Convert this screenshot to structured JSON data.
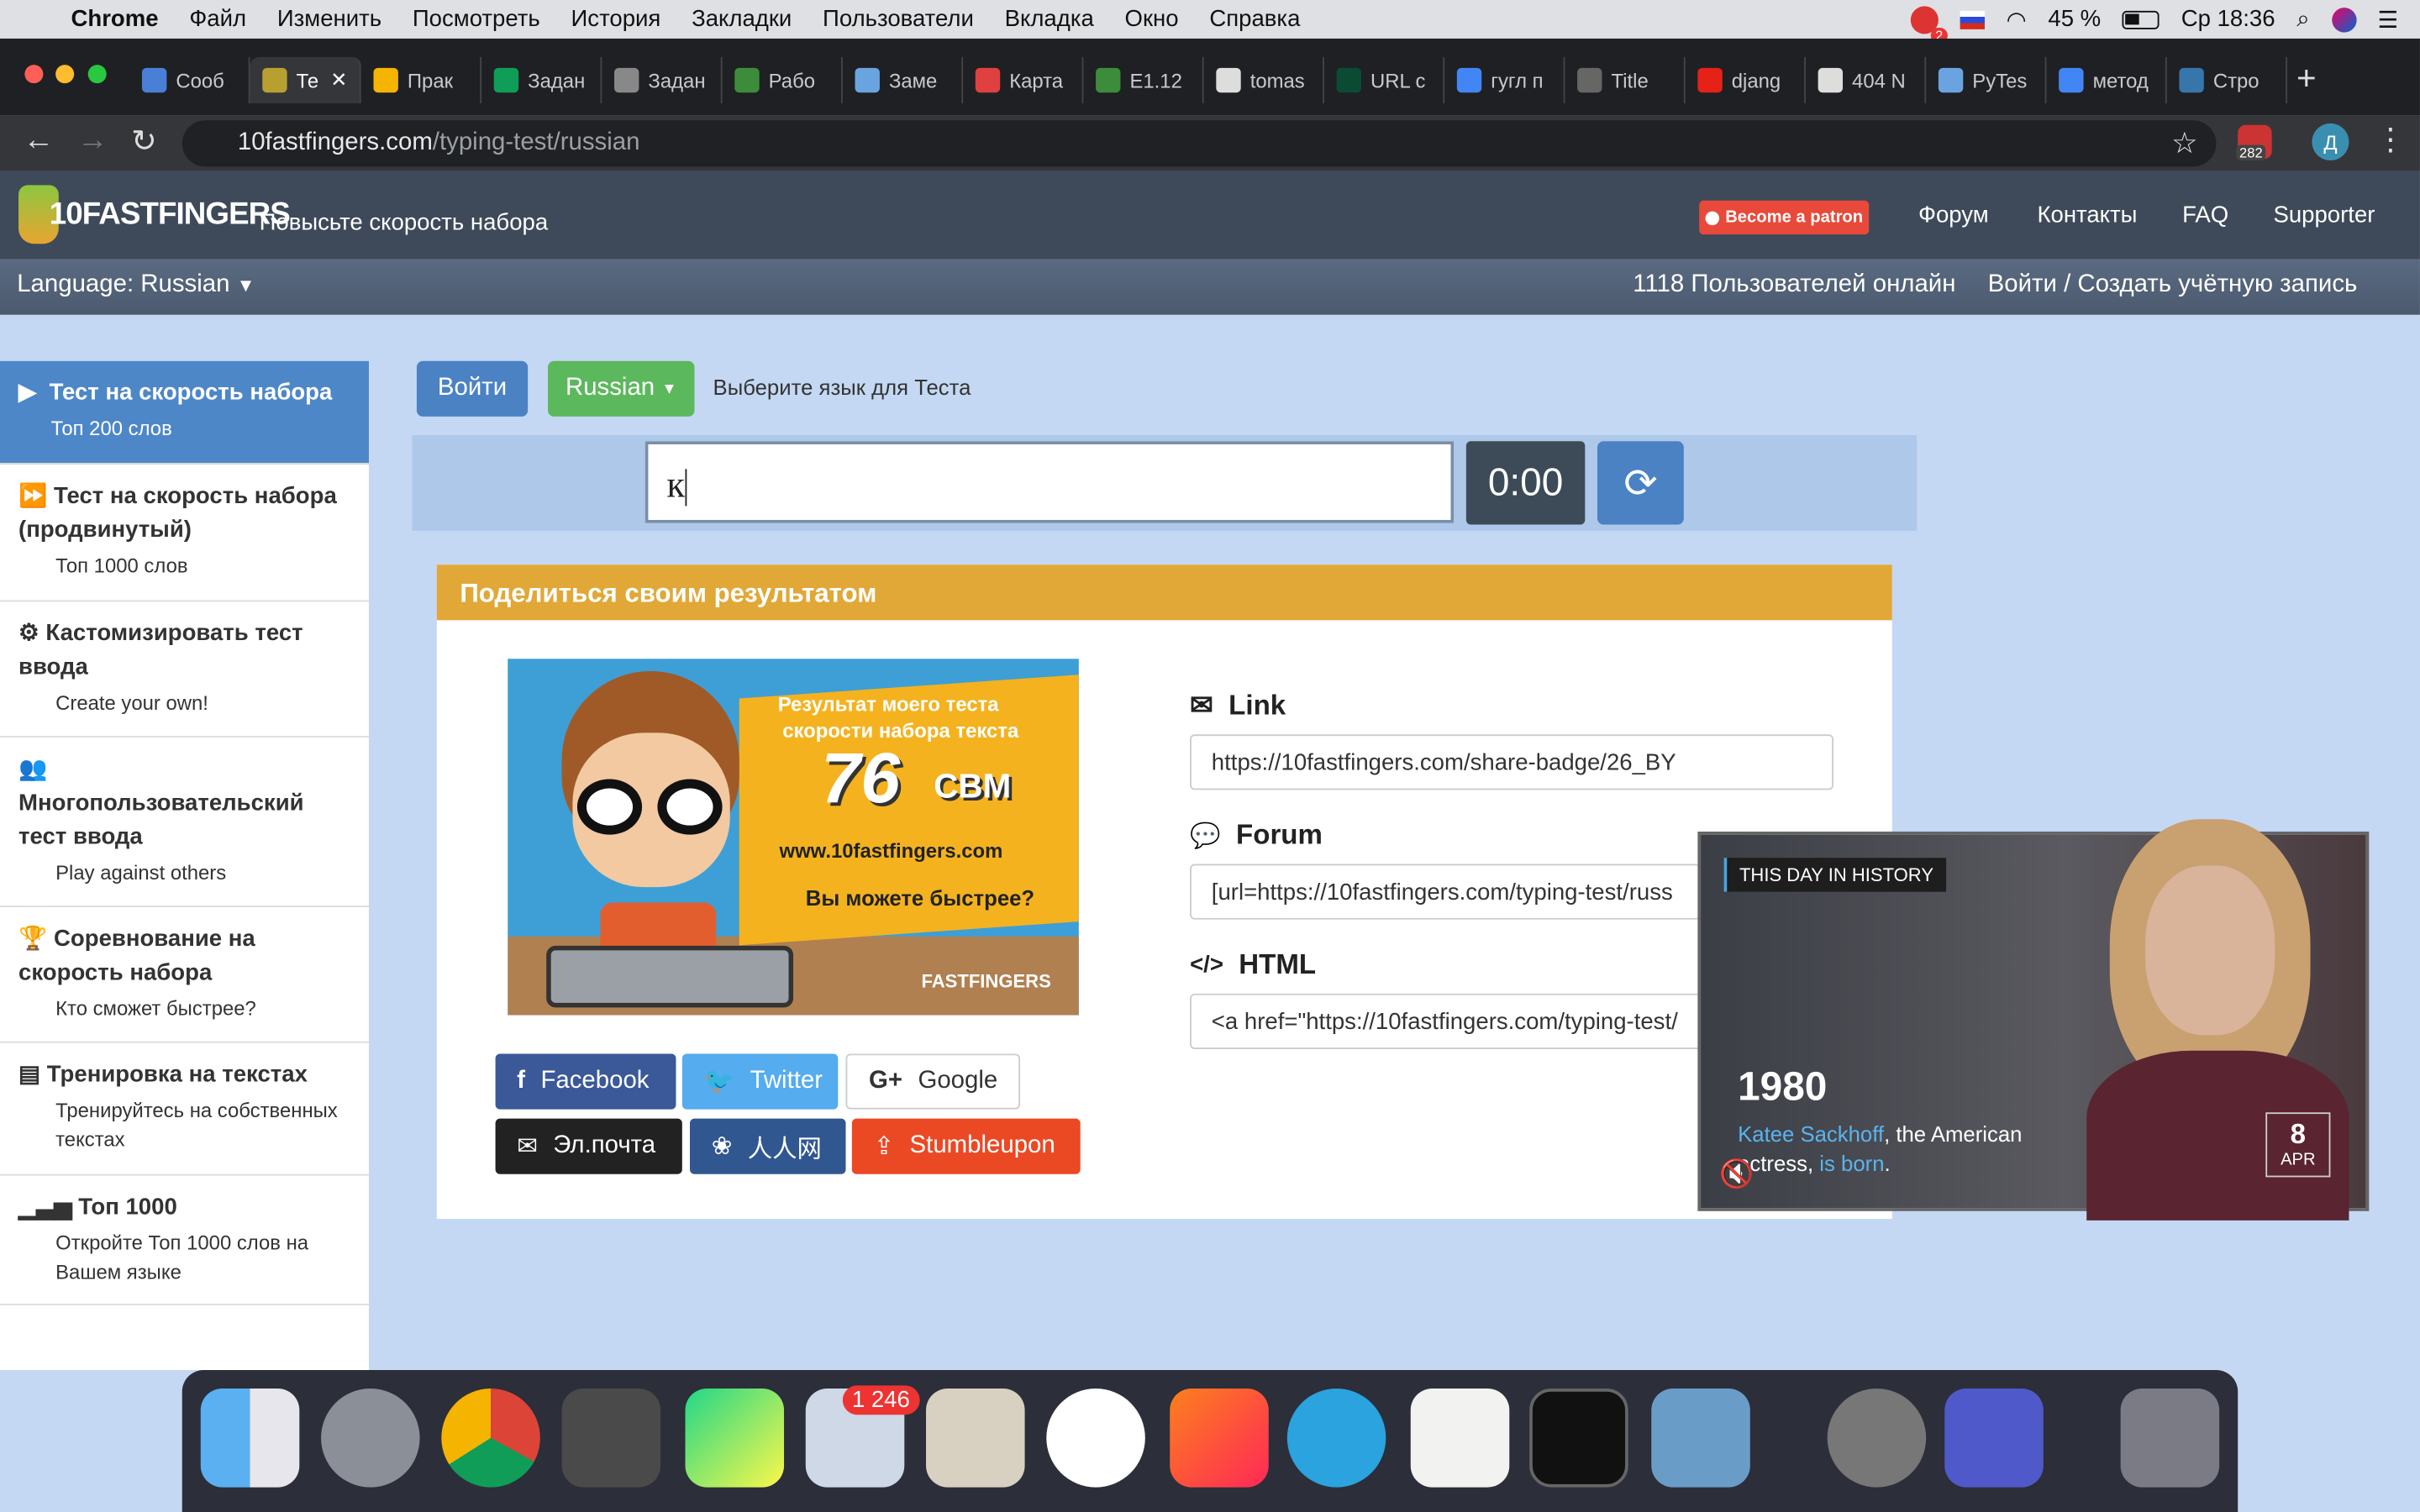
{
  "menubar": {
    "app": "Chrome",
    "items": [
      "Файл",
      "Изменить",
      "Посмотреть",
      "История",
      "Закладки",
      "Пользователи",
      "Вкладка",
      "Окно",
      "Справка"
    ],
    "battery": "45 %",
    "clock": "Ср 18:36",
    "notif_badge": "2"
  },
  "tabs": [
    {
      "label": "Сооб",
      "color": "#4a7fd8"
    },
    {
      "label": "Те",
      "color": "#b8a030",
      "active": true
    },
    {
      "label": "Прак",
      "color": "#f4b400"
    },
    {
      "label": "Задан",
      "color": "#0f9d58"
    },
    {
      "label": "Задан",
      "color": "#888"
    },
    {
      "label": "Рабо",
      "color": "#3c8c3c"
    },
    {
      "label": "Заме",
      "color": "#6aa4e0"
    },
    {
      "label": "Карта",
      "color": "#e04040"
    },
    {
      "label": "E1.12",
      "color": "#3c8c3c"
    },
    {
      "label": "tomas",
      "color": "#ddd"
    },
    {
      "label": "URL c",
      "color": "#0c4b33"
    },
    {
      "label": "гугл п",
      "color": "#4285f4"
    },
    {
      "label": "Title",
      "color": "#666"
    },
    {
      "label": "djang",
      "color": "#e62117"
    },
    {
      "label": "404 N",
      "color": "#ddd"
    },
    {
      "label": "PyTes",
      "color": "#6aa4e0"
    },
    {
      "label": "метод",
      "color": "#4285f4"
    },
    {
      "label": "Стро",
      "color": "#3776ab"
    }
  ],
  "toolbar": {
    "url_host": "10fastfingers.com",
    "url_path": "/typing-test/russian",
    "ext_badge": "282",
    "profile": "Д"
  },
  "site": {
    "logo": "10FASTFINGERS",
    "tagline": "Повысьте скорость набора",
    "patron": "Become a patron",
    "nav": [
      "Форум",
      "Контакты",
      "FAQ",
      "Supporter"
    ],
    "language": "Language: Russian",
    "online": "1118 Пользователей онлайн",
    "login": "Войти / Создать учётную запись"
  },
  "sidebar": [
    {
      "title": "Тест на скорость набора",
      "sub": "Топ 200 слов"
    },
    {
      "title": "Тест на скорость набора (продвинутый)",
      "sub": "Топ 1000 слов"
    },
    {
      "title": "Кастомизировать тест ввода",
      "sub": "Create your own!"
    },
    {
      "title": "Многопользовательский тест ввода",
      "sub": "Play against others"
    },
    {
      "title": "Соревнование на скорость набора",
      "sub": "Кто сможет быстрее?"
    },
    {
      "title": "Тренировка на текстах",
      "sub": "Тренируйтесь на собственных текстах"
    },
    {
      "title": "Топ 1000",
      "sub": "Откройте Топ 1000 слов на Вашем языке"
    }
  ],
  "main": {
    "login_btn": "Войти",
    "lang_btn": "Russian",
    "lang_hint": "Выберите язык для Теста",
    "input_value": "к",
    "timer": "0:00"
  },
  "share": {
    "header": "Поделиться своим результатом",
    "badge_line1": "Результат моего теста",
    "badge_line2": "скорости набора текста",
    "badge_speed": "76",
    "badge_unit": "СВМ",
    "badge_site": "www.10fastfingers.com",
    "badge_q": "Вы можете быстрее?",
    "badge_logo": "FASTFINGERS",
    "link_label": "Link",
    "link_value": "https://10fastfingers.com/share-badge/26_BY",
    "forum_label": "Forum",
    "forum_value": "[url=https://10fastfingers.com/typing-test/russ",
    "html_label": "HTML",
    "html_value": "<a href=\"https://10fastfingers.com/typing-test/",
    "buttons": [
      "Facebook",
      "Twitter",
      "Google",
      "Эл.почта",
      "人人网",
      "Stumbleupon"
    ]
  },
  "video": {
    "tag": "THIS DAY IN HISTORY",
    "year": "1980",
    "name": "Katee Sackhoff",
    "text1": ", the American",
    "text2": "actress, ",
    "is": "is",
    "born": "born",
    "period": ".",
    "day": "8",
    "month": "APR"
  },
  "dock": {
    "mail_badge": "1 246"
  }
}
